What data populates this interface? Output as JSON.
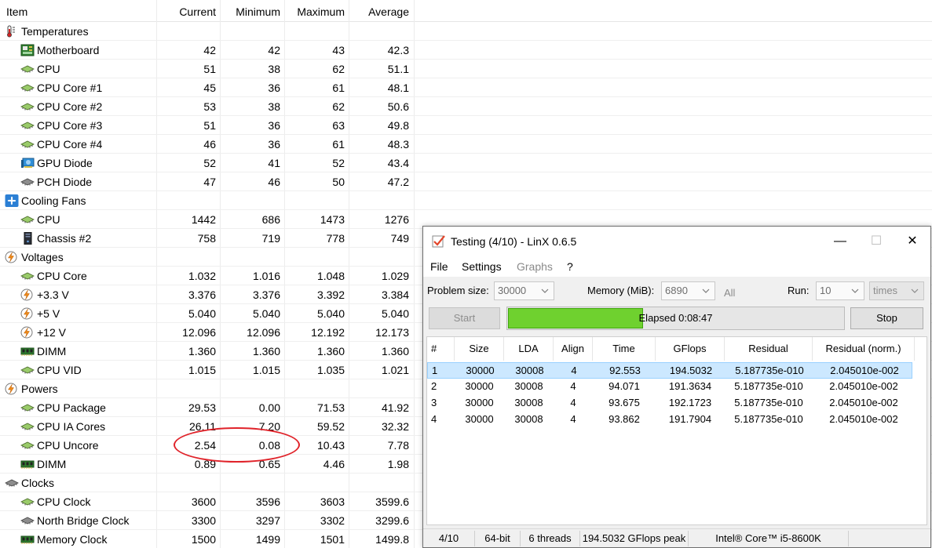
{
  "sensor_table": {
    "headers": [
      "Item",
      "Current",
      "Minimum",
      "Maximum",
      "Average"
    ],
    "rows": [
      {
        "kind": "group",
        "icon": "thermometer-icon",
        "name": "Temperatures"
      },
      {
        "kind": "item",
        "icon": "motherboard-icon",
        "name": "Motherboard",
        "current": "42",
        "minimum": "42",
        "maximum": "43",
        "average": "42.3"
      },
      {
        "kind": "item",
        "icon": "chip-icon",
        "name": "CPU",
        "current": "51",
        "minimum": "38",
        "maximum": "62",
        "average": "51.1"
      },
      {
        "kind": "item",
        "icon": "chip-icon",
        "name": "CPU Core #1",
        "current": "45",
        "minimum": "36",
        "maximum": "61",
        "average": "48.1"
      },
      {
        "kind": "item",
        "icon": "chip-icon",
        "name": "CPU Core #2",
        "current": "53",
        "minimum": "38",
        "maximum": "62",
        "average": "50.6"
      },
      {
        "kind": "item",
        "icon": "chip-icon",
        "name": "CPU Core #3",
        "current": "51",
        "minimum": "36",
        "maximum": "63",
        "average": "49.8"
      },
      {
        "kind": "item",
        "icon": "chip-icon",
        "name": "CPU Core #4",
        "current": "46",
        "minimum": "36",
        "maximum": "61",
        "average": "48.3"
      },
      {
        "kind": "item",
        "icon": "gpu-icon",
        "name": "GPU Diode",
        "current": "52",
        "minimum": "41",
        "maximum": "52",
        "average": "43.4"
      },
      {
        "kind": "item",
        "icon": "flat-chip-icon",
        "name": "PCH Diode",
        "current": "47",
        "minimum": "46",
        "maximum": "50",
        "average": "47.2"
      },
      {
        "kind": "group",
        "icon": "fan-icon",
        "name": "Cooling Fans"
      },
      {
        "kind": "item",
        "icon": "chip-icon",
        "name": "CPU",
        "current": "1442",
        "minimum": "686",
        "maximum": "1473",
        "average": "1276"
      },
      {
        "kind": "item",
        "icon": "chassis-icon",
        "name": "Chassis #2",
        "current": "758",
        "minimum": "719",
        "maximum": "778",
        "average": "749"
      },
      {
        "kind": "group",
        "icon": "bolt-icon",
        "name": "Voltages"
      },
      {
        "kind": "item",
        "icon": "chip-icon",
        "name": "CPU Core",
        "current": "1.032",
        "minimum": "1.016",
        "maximum": "1.048",
        "average": "1.029"
      },
      {
        "kind": "item",
        "icon": "bolt-icon",
        "name": "+3.3 V",
        "current": "3.376",
        "minimum": "3.376",
        "maximum": "3.392",
        "average": "3.384"
      },
      {
        "kind": "item",
        "icon": "bolt-icon",
        "name": "+5 V",
        "current": "5.040",
        "minimum": "5.040",
        "maximum": "5.040",
        "average": "5.040"
      },
      {
        "kind": "item",
        "icon": "bolt-icon",
        "name": "+12 V",
        "current": "12.096",
        "minimum": "12.096",
        "maximum": "12.192",
        "average": "12.173"
      },
      {
        "kind": "item",
        "icon": "dimm-icon",
        "name": "DIMM",
        "current": "1.360",
        "minimum": "1.360",
        "maximum": "1.360",
        "average": "1.360"
      },
      {
        "kind": "item",
        "icon": "chip-icon",
        "name": "CPU VID",
        "current": "1.015",
        "minimum": "1.015",
        "maximum": "1.035",
        "average": "1.021"
      },
      {
        "kind": "group",
        "icon": "bolt-icon",
        "name": "Powers"
      },
      {
        "kind": "item",
        "icon": "chip-icon",
        "name": "CPU Package",
        "current": "29.53",
        "minimum": "0.00",
        "maximum": "71.53",
        "average": "41.92"
      },
      {
        "kind": "item",
        "icon": "chip-icon",
        "name": "CPU IA Cores",
        "current": "26.11",
        "minimum": "7.20",
        "maximum": "59.52",
        "average": "32.32"
      },
      {
        "kind": "item",
        "icon": "chip-icon",
        "name": "CPU Uncore",
        "current": "2.54",
        "minimum": "0.08",
        "maximum": "10.43",
        "average": "7.78"
      },
      {
        "kind": "item",
        "icon": "dimm-icon",
        "name": "DIMM",
        "current": "0.89",
        "minimum": "0.65",
        "maximum": "4.46",
        "average": "1.98"
      },
      {
        "kind": "group",
        "icon": "flat-chip-icon",
        "name": "Clocks"
      },
      {
        "kind": "item",
        "icon": "chip-icon",
        "name": "CPU Clock",
        "current": "3600",
        "minimum": "3596",
        "maximum": "3603",
        "average": "3599.6"
      },
      {
        "kind": "item",
        "icon": "flat-chip-icon",
        "name": "North Bridge Clock",
        "current": "3300",
        "minimum": "3297",
        "maximum": "3302",
        "average": "3299.6"
      },
      {
        "kind": "item",
        "icon": "dimm-icon",
        "name": "Memory Clock",
        "current": "1500",
        "minimum": "1499",
        "maximum": "1501",
        "average": "1499.8"
      }
    ]
  },
  "linx": {
    "title": "Testing (4/10) - LinX 0.6.5",
    "window_controls": {
      "minimize": "—",
      "maximize": "☐",
      "close": "✕"
    },
    "menu": [
      {
        "label": "File",
        "enabled": true
      },
      {
        "label": "Settings",
        "enabled": true
      },
      {
        "label": "Graphs",
        "enabled": false
      },
      {
        "label": "?",
        "enabled": true
      }
    ],
    "problem_size_label": "Problem size:",
    "problem_size_value": "30000",
    "memory_label": "Memory (MiB):",
    "memory_value": "6890",
    "memory_all": "All",
    "run_label": "Run:",
    "run_value": "10",
    "run_unit": "times",
    "start_button": "Start",
    "stop_button": "Stop",
    "progress_text": "Elapsed 0:08:47",
    "progress_fraction": 0.4,
    "progress_color": "#6fd12f",
    "results": {
      "headers": [
        "#",
        "Size",
        "LDA",
        "Align",
        "Time",
        "GFlops",
        "Residual",
        "Residual (norm.)"
      ],
      "rows": [
        [
          "1",
          "30000",
          "30008",
          "4",
          "92.553",
          "194.5032",
          "5.187735e-010",
          "2.045010e-002"
        ],
        [
          "2",
          "30000",
          "30008",
          "4",
          "94.071",
          "191.3634",
          "5.187735e-010",
          "2.045010e-002"
        ],
        [
          "3",
          "30000",
          "30008",
          "4",
          "93.675",
          "192.1723",
          "5.187735e-010",
          "2.045010e-002"
        ],
        [
          "4",
          "30000",
          "30008",
          "4",
          "93.862",
          "191.7904",
          "5.187735e-010",
          "2.045010e-002"
        ]
      ],
      "selected_row": 0,
      "selection_color": "#cce8ff"
    },
    "status": [
      "4/10",
      "64-bit",
      "6 threads",
      "194.5032 GFlops peak",
      "Intel® Core™ i5-8600K"
    ]
  },
  "annotation_color": "#e0232a"
}
